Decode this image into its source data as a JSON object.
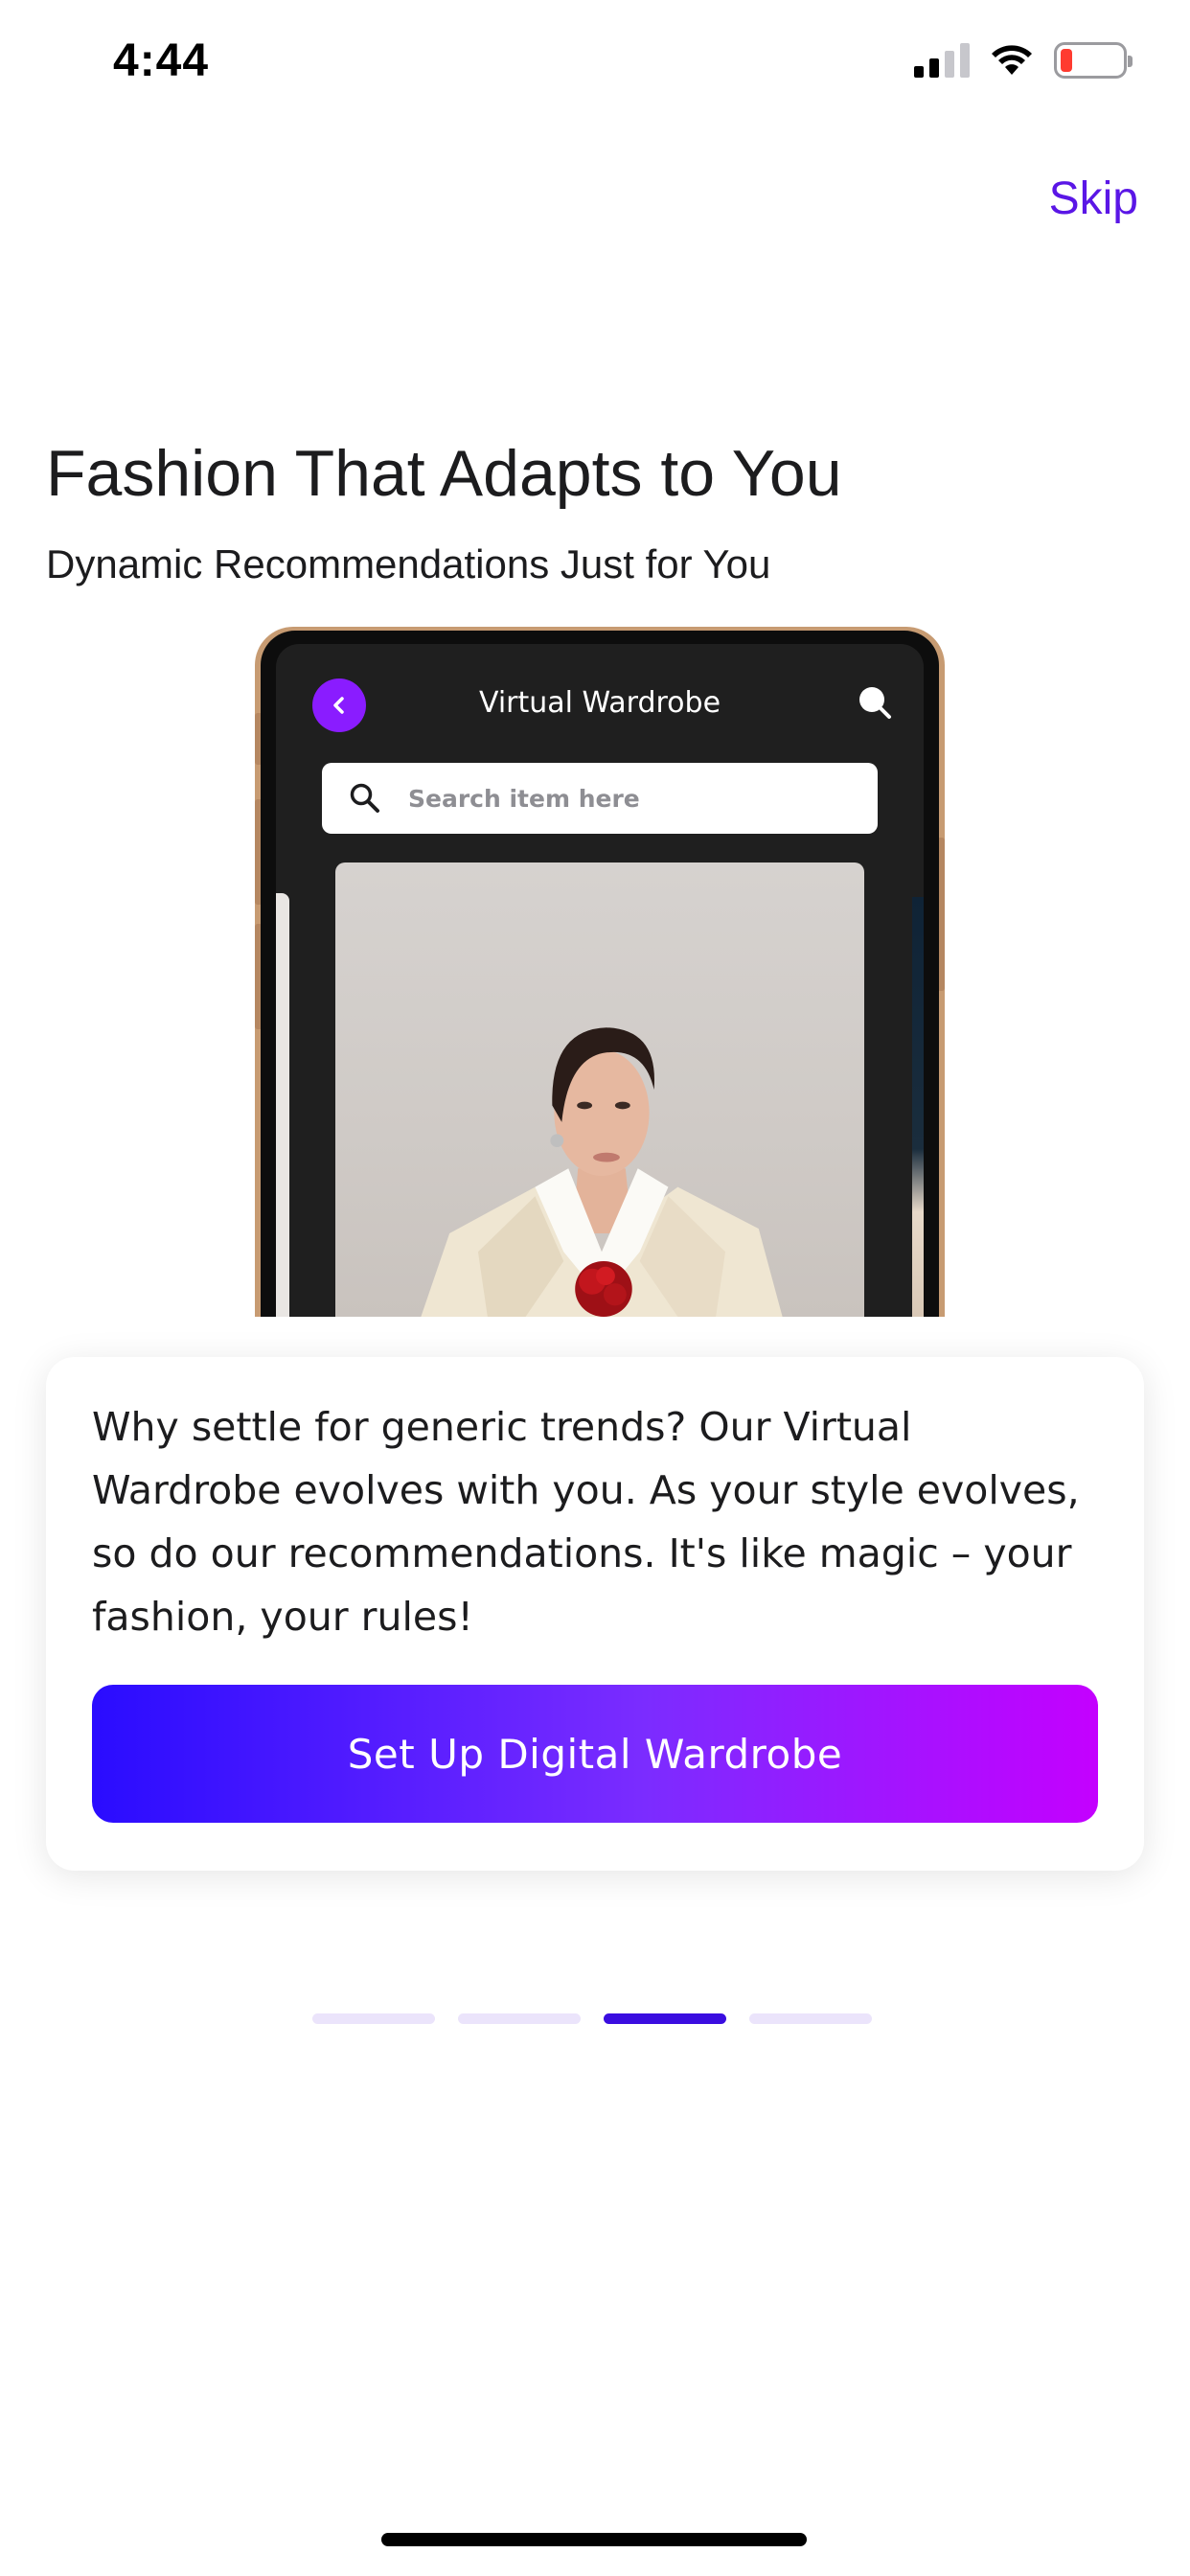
{
  "status_bar": {
    "time": "4:44",
    "signal_icon": "cellular-signal-icon",
    "wifi_icon": "wifi-icon",
    "battery_icon": "battery-low-icon",
    "battery_color": "#ff3b30"
  },
  "header": {
    "skip_label": "Skip"
  },
  "hero": {
    "title": "Fashion That Adapts to You",
    "subtitle": "Dynamic Recommendations Just for You"
  },
  "phone_preview": {
    "screen_title": "Virtual Wardrobe",
    "back_icon": "chevron-left-icon",
    "search_icon": "search-icon",
    "search_placeholder": "Search item here",
    "accent_color": "#8a1cff"
  },
  "card": {
    "description": "Why settle for generic trends? Our Virtual Wardrobe evolves with you. As your style evolves, so do our recommendations. It's like magic – your fashion, your rules!",
    "cta_label": "Set Up Digital Wardrobe",
    "cta_gradient": [
      "#2a0cff",
      "#c400ff"
    ]
  },
  "pagination": {
    "total": 4,
    "active_index": 2,
    "active_color": "#3a0de0",
    "inactive_color": "#ebe4fb"
  },
  "brand": {
    "accent": "#5a16e6"
  }
}
